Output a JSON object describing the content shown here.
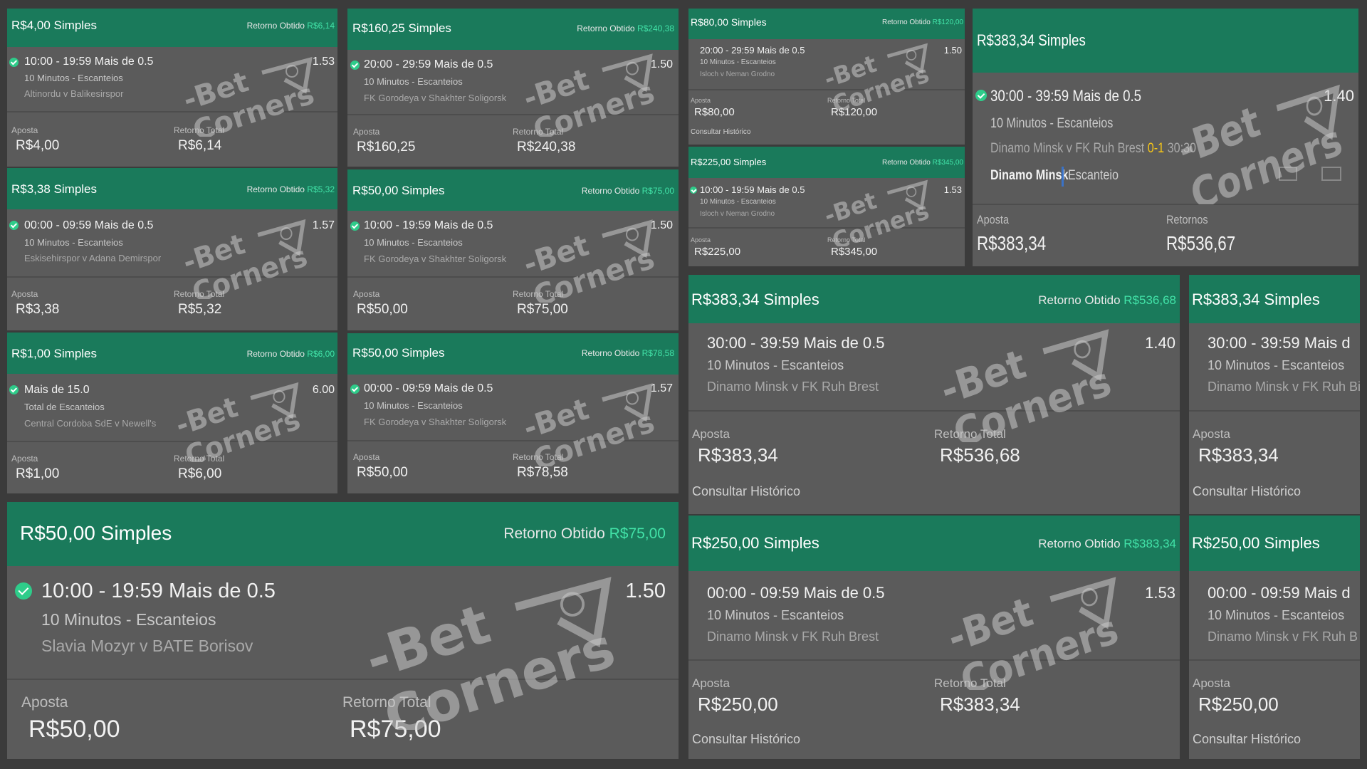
{
  "labels": {
    "aposta": "Aposta",
    "retorno_total": "Retorno Total",
    "retornos": "Retornos",
    "retorno_obtido": "Retorno Obtido",
    "consultar": "Consultar Histórico"
  },
  "watermark": {
    "line1": "-Bet",
    "line2": "Corners"
  },
  "colors": {
    "header": "#1a7a5b",
    "win_value": "#42e3a8",
    "check": "#2ecc8a",
    "card": "#5b5b5b",
    "score": "#f5c518"
  },
  "bets": [
    {
      "title": "R$4,00 Simples",
      "obtido": "R$6,14",
      "market": "10:00 - 19:59 Mais de 0.5",
      "sub": "10 Minutos - Escanteios",
      "match": "Altinordu v Balikesirspor",
      "odds": "1.53",
      "aposta": "R$4,00",
      "retorno": "R$6,14"
    },
    {
      "title": "R$3,38 Simples",
      "obtido": "R$5,32",
      "market": "00:00 - 09:59 Mais de 0.5",
      "sub": "10 Minutos - Escanteios",
      "match": "Eskisehirspor v Adana Demirspor",
      "odds": "1.57",
      "aposta": "R$3,38",
      "retorno": "R$5,32"
    },
    {
      "title": "R$1,00 Simples",
      "obtido": "R$6,00",
      "market": "Mais de 15.0",
      "sub": "Total de Escanteios",
      "match": "Central Cordoba SdE v Newell's",
      "odds": "6.00",
      "aposta": "R$1,00",
      "retorno": "R$6,00"
    },
    {
      "title": "R$160,25 Simples",
      "obtido": "R$240,38",
      "market": "20:00 - 29:59 Mais de 0.5",
      "sub": "10 Minutos - Escanteios",
      "match": "FK Gorodeya v Shakhter Soligorsk",
      "odds": "1.50",
      "aposta": "R$160,25",
      "retorno": "R$240,38"
    },
    {
      "title": "R$50,00 Simples",
      "obtido": "R$75,00",
      "market": "10:00 - 19:59 Mais de 0.5",
      "sub": "10 Minutos - Escanteios",
      "match": "FK Gorodeya v Shakhter Soligorsk",
      "odds": "1.50",
      "aposta": "R$50,00",
      "retorno": "R$75,00"
    },
    {
      "title": "R$50,00 Simples",
      "obtido": "R$78,58",
      "market": "00:00 - 09:59 Mais de 0.5",
      "sub": "10 Minutos - Escanteios",
      "match": "FK Gorodeya v Shakhter Soligorsk",
      "odds": "1.57",
      "aposta": "R$50,00",
      "retorno": "R$78,58"
    },
    {
      "title": "R$80,00 Simples",
      "obtido": "R$120,00",
      "market": "20:00 - 29:59 Mais de 0.5",
      "sub": "10 Minutos - Escanteios",
      "match": "Isloch v Neman Grodno",
      "odds": "1.50",
      "aposta": "R$80,00",
      "retorno": "R$120,00"
    },
    {
      "title": "R$225,00 Simples",
      "obtido": "R$345,00",
      "market": "10:00 - 19:59 Mais de 0.5",
      "sub": "10 Minutos - Escanteios",
      "match": "Isloch v Neman Grodno",
      "odds": "1.53",
      "aposta": "R$225,00",
      "retorno": "R$345,00"
    },
    {
      "title": "R$383,34 Simples",
      "market": "30:00 - 39:59 Mais de 0.5",
      "sub": "10 Minutos - Escanteios",
      "match": "Dinamo Minsk v FK Ruh Brest",
      "score": "0-1",
      "time": "30:30",
      "team_a": "Dinamo Minsk",
      "team_b": "Escanteio",
      "odds": "1.40",
      "aposta": "R$383,34",
      "retorno": "R$536,67"
    },
    {
      "title": "R$50,00 Simples",
      "obtido": "R$75,00",
      "market": "10:00 - 19:59 Mais de 0.5",
      "sub": "10 Minutos - Escanteios",
      "match": "Slavia Mozyr v BATE Borisov",
      "odds": "1.50",
      "aposta": "R$50,00",
      "retorno": "R$75,00"
    },
    {
      "title": "R$383,34 Simples",
      "obtido": "R$536,68",
      "market": "30:00 - 39:59 Mais de 0.5",
      "sub": "10 Minutos - Escanteios",
      "match": "Dinamo Minsk v FK Ruh Brest",
      "odds": "1.40",
      "aposta": "R$383,34",
      "retorno": "R$536,68"
    },
    {
      "title": "R$250,00 Simples",
      "obtido": "R$383,34",
      "market": "00:00 - 09:59 Mais de 0.5",
      "sub": "10 Minutos - Escanteios",
      "match": "Dinamo Minsk v FK Ruh Brest",
      "odds": "1.53",
      "aposta": "R$250,00",
      "retorno": "R$383,34"
    },
    {
      "title": "R$383,34 Simples",
      "market": "30:00 - 39:59 Mais d",
      "sub": "10 Minutos - Escanteios",
      "match": "Dinamo Minsk v FK Ruh Bi",
      "aposta": "R$383,34"
    },
    {
      "title": "R$250,00 Simples",
      "market": "00:00 - 09:59 Mais d",
      "sub": "10 Minutos - Escanteios",
      "match": "Dinamo Minsk v FK Ruh B",
      "aposta": "R$250,00"
    }
  ]
}
